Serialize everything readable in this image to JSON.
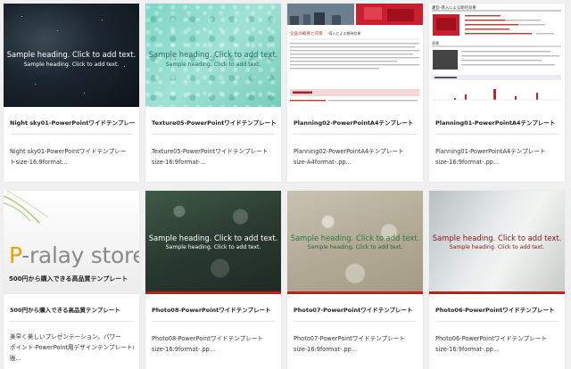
{
  "cards": [
    {
      "thumb": {
        "heading": "Sample heading. Click to add text.",
        "sub": "Sample heading. Click to add text."
      },
      "title": "Night sky01-PowerPointワイドテンプレー",
      "desc": [
        "Night sky01-PowerPointワイドテンプレー",
        "トsize-16:9format..."
      ]
    },
    {
      "thumb": {
        "heading": "Sample heading. Click to add text.",
        "sub": "Sample heading. Click to add text."
      },
      "title": "Texture05-PowerPointワイドテンプレート",
      "desc": [
        "Texture05-PowerPointワイドテンプレート",
        "size-16:9format-..."
      ]
    },
    {
      "thumb": {
        "doc_title": "企画の概要と背景",
        "doc_sub": "-導入による期待効果"
      },
      "title": "Planning02-PowerPointA4テンプレート",
      "desc": [
        "Planning02-PowerPointA4テンプレート",
        "size-A4format-.pp..."
      ]
    },
    {
      "thumb": {
        "doc_title": "趣旨-導入による期待効果",
        "doc_sub": "背景"
      },
      "title": "Planning01-PowerPointA4テンプレート",
      "desc": [
        "Planning01-PowerPointA4テンプレート",
        "size-16:9format-.pp..."
      ]
    },
    {
      "thumb": {
        "logo_p": "P",
        "logo_rest": "-ralay",
        "logo_store": "store",
        "tagline": "500円から購入できる高品質テンプレート"
      },
      "title": "500円から購入できる高品質テンプレート",
      "desc": [
        "美早く美しいプレゼンテーション。パワー",
        "ポイント-PowerPoint用デザインテンプレートの",
        "販..."
      ]
    },
    {
      "thumb": {
        "heading": "Sample heading. Click to add text.",
        "sub": "Sample heading. Click to add text."
      },
      "title": "Photo08-PowerPointワイドテンプレート",
      "desc": [
        "Photo08-PowerPointワイドテンプレート",
        "size-16:9format-.pp..."
      ]
    },
    {
      "thumb": {
        "heading": "Sample heading. Click to add text.",
        "sub": "Sample heading. Click to add text."
      },
      "title": "Photo07-PowerPointワイドテンプレート",
      "desc": [
        "Photo07-PowerPointワイドテンプレート",
        "size-16:9format-.pp..."
      ]
    },
    {
      "thumb": {
        "heading": "Sample heading. Click to add text.",
        "sub": "Sample heading. Click to add text."
      },
      "title": "Photo06-PowerPointワイドテンプレート",
      "desc": [
        "Photo06-PowerPointワイドテンプレート",
        "size-16:9format-.pp..."
      ]
    }
  ],
  "colors": {
    "accent_red": "#d0181b",
    "logo_orange": "#f0a000",
    "logo_gray": "#8a8a8a"
  }
}
